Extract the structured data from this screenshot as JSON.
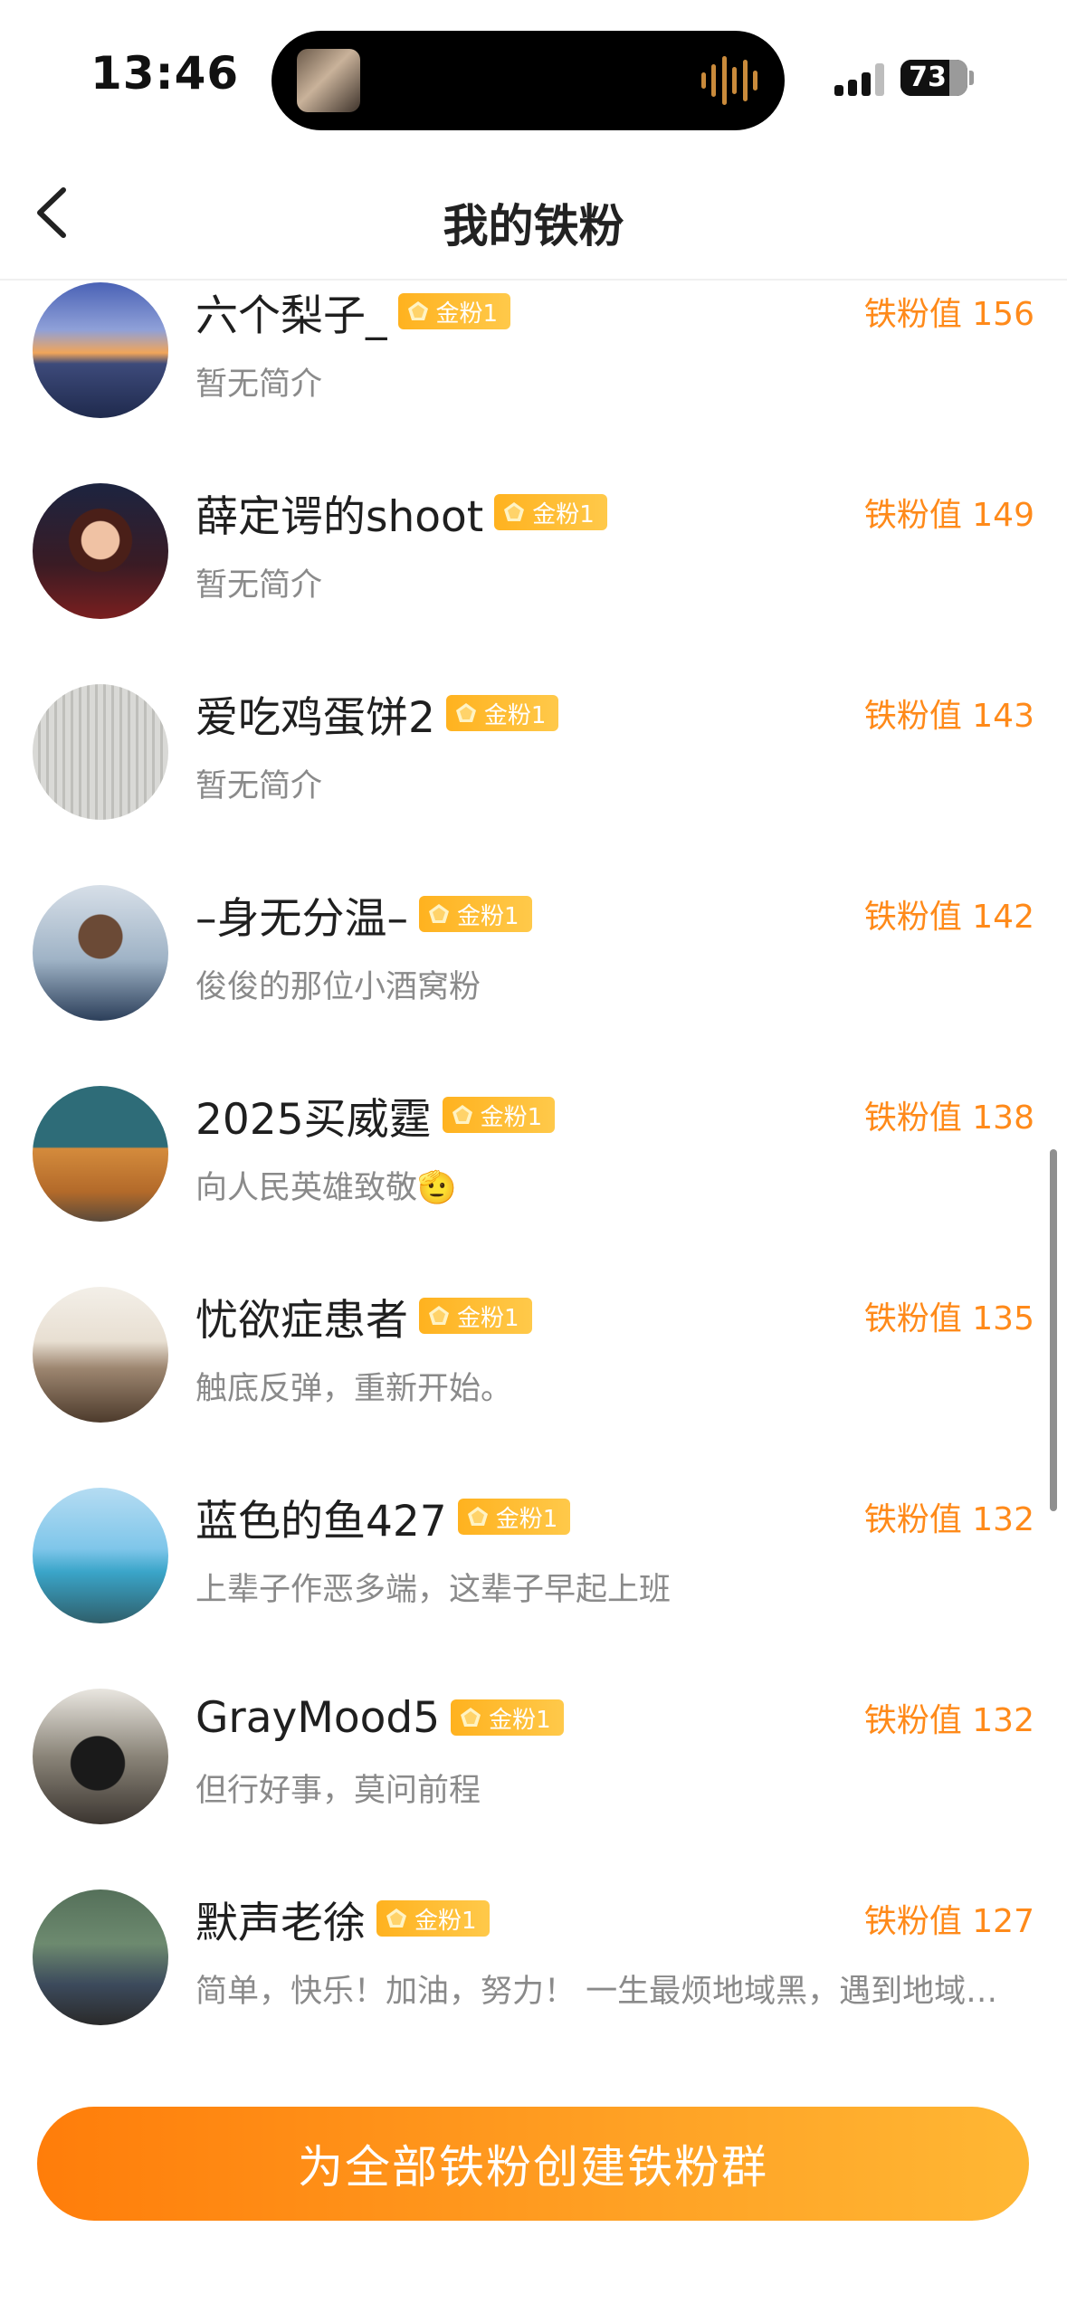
{
  "status_bar": {
    "time": "13:46",
    "battery": "73"
  },
  "nav": {
    "title": "我的铁粉",
    "back_icon": "chevron-left-icon"
  },
  "fans": [
    {
      "name": "六个梨子_",
      "badge": "金粉1",
      "score": "铁粉值 156",
      "bio": "暂无简介"
    },
    {
      "name": "薛定谔的shoot",
      "badge": "金粉1",
      "score": "铁粉值 149",
      "bio": "暂无简介"
    },
    {
      "name": "爱吃鸡蛋饼2",
      "badge": "金粉1",
      "score": "铁粉值 143",
      "bio": "暂无简介"
    },
    {
      "name": "–身无分温–",
      "badge": "金粉1",
      "score": "铁粉值 142",
      "bio": "俊俊的那位小酒窝粉"
    },
    {
      "name": "2025买威霆",
      "badge": "金粉1",
      "score": "铁粉值 138",
      "bio": "向人民英雄致敬🫡"
    },
    {
      "name": "忧欲症患者",
      "badge": "金粉1",
      "score": "铁粉值 135",
      "bio": "触底反弹，重新开始。"
    },
    {
      "name": "蓝色的鱼427",
      "badge": "金粉1",
      "score": "铁粉值 132",
      "bio": "上辈子作恶多端，这辈子早起上班"
    },
    {
      "name": "GrayMood5",
      "badge": "金粉1",
      "score": "铁粉值 132",
      "bio": "但行好事，莫问前程"
    },
    {
      "name": "默声老徐",
      "badge": "金粉1",
      "score": "铁粉值 127",
      "bio": "简单，快乐！加油，努力！ 一生最烦地域黑，遇到地域…"
    }
  ],
  "cta": {
    "label": "为全部铁粉创建铁粉群"
  },
  "colors": {
    "accent": "#ff8a1a",
    "badge": "#ffb21f",
    "cta_start": "#ff7d0a",
    "cta_end": "#ffb734"
  }
}
